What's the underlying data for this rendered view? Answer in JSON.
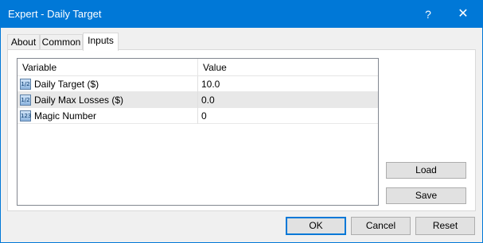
{
  "window": {
    "title": "Expert - Daily Target",
    "help_glyph": "?",
    "close_glyph": "✕"
  },
  "tabs": [
    {
      "label": "About"
    },
    {
      "label": "Common"
    },
    {
      "label": "Inputs"
    }
  ],
  "grid": {
    "columns": [
      "Variable",
      "Value"
    ],
    "rows": [
      {
        "icon": "double-value-icon",
        "icon_text": "1/2",
        "variable": "Daily Target ($)",
        "value": "10.0"
      },
      {
        "icon": "double-value-icon",
        "icon_text": "1/2",
        "variable": "Daily Max Losses ($)",
        "value": "0.0"
      },
      {
        "icon": "integer-value-icon",
        "icon_text": "123",
        "variable": "Magic Number",
        "value": "0"
      }
    ]
  },
  "side_buttons": {
    "load": "Load",
    "save": "Save"
  },
  "footer_buttons": {
    "ok": "OK",
    "cancel": "Cancel",
    "reset": "Reset"
  },
  "colors": {
    "titlebar": "#0078d7",
    "selected_row": "#e8e8e8"
  }
}
